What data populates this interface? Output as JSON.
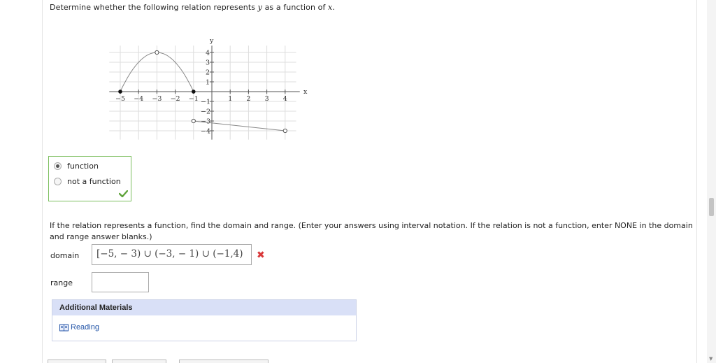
{
  "question": {
    "prefix": "Determine whether the following relation represents ",
    "var_y": "y",
    "middle": " as a function of ",
    "var_x": "x",
    "suffix": "."
  },
  "graph": {
    "x_axis_label": "x",
    "y_axis_label": "y",
    "x_tick_labels": [
      "−5",
      "−4",
      "−3",
      "−2",
      "−1",
      "1",
      "2",
      "3",
      "4"
    ],
    "y_tick_labels": [
      "4",
      "3",
      "2",
      "1",
      "−1",
      "−2",
      "−3",
      "−4"
    ],
    "curve_points": {
      "parabola": [
        [
          -5,
          0
        ],
        [
          -3,
          4
        ],
        [
          -1,
          0
        ]
      ],
      "line": [
        [
          -1,
          -3
        ],
        [
          4,
          -4
        ]
      ]
    },
    "closed_points": [
      [
        -5,
        0
      ],
      [
        -1,
        0
      ]
    ],
    "open_points": [
      [
        -3,
        4
      ],
      [
        -1,
        -3
      ],
      [
        4,
        -4
      ]
    ]
  },
  "choices": [
    {
      "label": "function",
      "selected": true
    },
    {
      "label": "not a function",
      "selected": false
    }
  ],
  "choice_status_icon": "green-check-icon",
  "instructions": "If the relation represents a function, find the domain and range. (Enter your answers using interval notation. If the relation is not a function, enter NONE in the domain and range answer blanks.)",
  "domain": {
    "label": "domain",
    "value": "[−5, − 3) ∪ (−3, − 1) ∪ (−1,4)",
    "status_icon": "red-x-icon"
  },
  "range": {
    "label": "range",
    "value": ""
  },
  "materials": {
    "heading": "Additional Materials",
    "link_label": "Reading",
    "link_icon": "book-icon"
  },
  "colors": {
    "correct": "#5fa33a",
    "incorrect": "#d9383a",
    "materials_header": "#d9e0f7",
    "link": "#2556a8"
  }
}
